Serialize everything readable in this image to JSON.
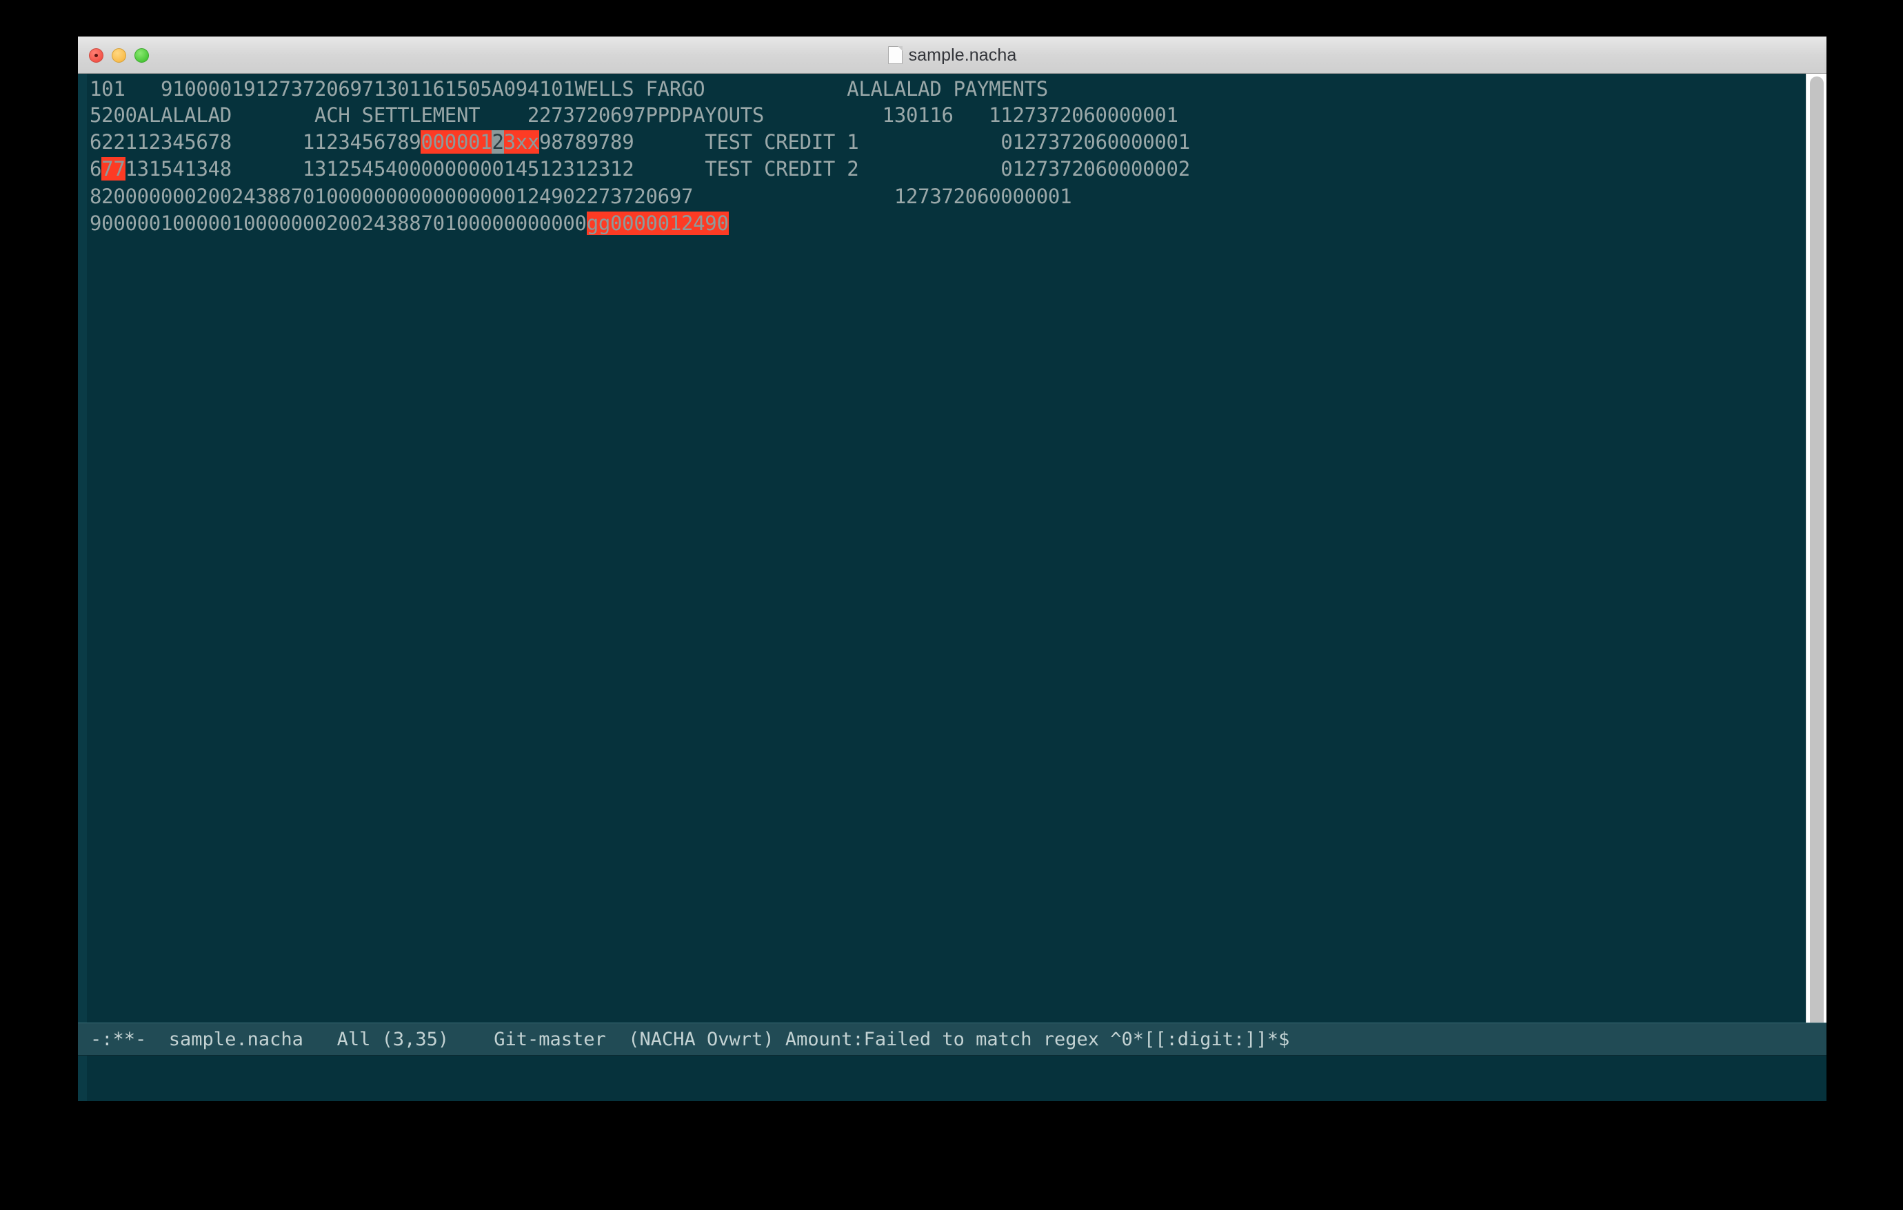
{
  "window": {
    "title": "sample.nacha",
    "doc_icon": "document-icon",
    "traffic_lights": [
      {
        "name": "close",
        "color": "#f35449"
      },
      {
        "name": "minimize",
        "color": "#f9bd4e"
      },
      {
        "name": "maximize",
        "color": "#4cc83a"
      }
    ]
  },
  "colors": {
    "background": "#06323c",
    "foreground": "#9aa8a9",
    "highlight_bg": "#fd3b24",
    "cursor_bg": "#8b9a9b",
    "modeline_bg": "#214b55",
    "modeline_fg": "#c3d2d3",
    "fringe": "#0a3b46",
    "scrollbar_track": "#ffffff",
    "scrollbar_thumb": "#c3c3c3"
  },
  "buffer": {
    "name": "sample.nacha",
    "lines": [
      {
        "index": 1,
        "segments": [
          {
            "text": "101   9100001912737206971301161505A094101WELLS FARGO            ALALALAD PAYMENTS",
            "style": "normal"
          }
        ]
      },
      {
        "index": 2,
        "segments": [
          {
            "text": "5200ALALALAD       ACH SETTLEMENT    2273720697PPDPAYOUTS          130116   1127372060000001",
            "style": "normal"
          }
        ]
      },
      {
        "index": 3,
        "segments": [
          {
            "text": "622112345678      1123456789",
            "style": "normal"
          },
          {
            "text": "000001",
            "style": "highlight"
          },
          {
            "text": "2",
            "style": "cursor"
          },
          {
            "text": "3xx",
            "style": "highlight"
          },
          {
            "text": "98789789      TEST CREDIT 1            0127372060000001",
            "style": "normal"
          }
        ]
      },
      {
        "index": 4,
        "segments": [
          {
            "text": "6",
            "style": "normal"
          },
          {
            "text": "77",
            "style": "highlight"
          },
          {
            "text": "131541348      131254540000000001",
            "style": "normal"
          },
          {
            "text": "4512312312      TEST CREDIT 2            0127372060000002",
            "style": "normal"
          }
        ]
      },
      {
        "index": 5,
        "segments": [
          {
            "text": "820000000200243887010000000000000000124902273720697                 127372060000001",
            "style": "normal"
          }
        ]
      },
      {
        "index": 6,
        "segments": [
          {
            "text": "900000100000100000002002438870100000000000",
            "style": "normal"
          },
          {
            "text": "gg0000012490",
            "style": "highlight"
          }
        ]
      }
    ]
  },
  "modeline": {
    "text": "-:**-  sample.nacha   All (3,35)    Git-master  (NACHA Ovwrt) Amount:Failed to match regex ^0*[[:digit:]]*$",
    "parts": {
      "status_flags": "-:**-",
      "buffer_name": "sample.nacha",
      "position": "All (3,35)",
      "vc_state": "Git-master",
      "major_mode": "(NACHA Ovwrt)",
      "error_message": "Amount:Failed to match regex ^0*[[:digit:]]*$"
    }
  },
  "minibuffer": {
    "text": ""
  },
  "scrollbar": {
    "thumb_position_percent": 0,
    "thumb_size_percent": 97
  }
}
